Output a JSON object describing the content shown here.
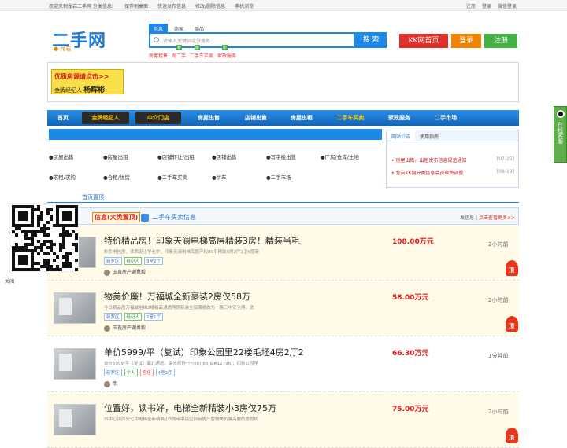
{
  "topbar": {
    "welcome": "欢迎来到龙岩二手网 分类信息!",
    "links": [
      "保存到桌面",
      "快速发布信息",
      "修改/删除信息",
      "手机浏览"
    ],
    "right": [
      "注册",
      "登录",
      "微信登录"
    ]
  },
  "header": {
    "logo": "二手网",
    "city": "龙岩",
    "search_tabs": [
      "信息",
      "商家",
      "商品"
    ],
    "search_placeholder": "请输入关键词或分类名",
    "search_button": "搜 索",
    "hot": [
      {
        "label": "房屋租售",
        "badge": ""
      },
      {
        "label": "淘二手",
        "badge": "新"
      },
      {
        "label": "二手车买卖",
        "badge": "新"
      },
      {
        "label": "家政服务",
        "badge": "新"
      }
    ],
    "buttons": {
      "home": "KK网首页",
      "login": "登录",
      "register": "注册"
    }
  },
  "banner": {
    "line1": "优质房源请点击>>",
    "line2_prefix": "金牌经纪人",
    "line2_name": "杨辉彬"
  },
  "nav": [
    "首页",
    "金牌经纪人",
    "中介门店",
    "房屋出售",
    "店铺出售",
    "房屋出租",
    "二手车买卖",
    "家政服务",
    "二手市场"
  ],
  "categories": [
    [
      "●房屋出售",
      "●房屋出租",
      "●店铺转让/出租",
      "●店铺出售",
      "●写字楼出售",
      "●厂房/仓库/土地"
    ],
    [
      "●求租/求购",
      "●合租/拼房",
      "●二手车买卖",
      "●拼车",
      "●二手市场"
    ]
  ],
  "notice": {
    "tabs": [
      "网站公告",
      "使用指南"
    ],
    "items": [
      {
        "text": "• 房屋出售、出租发布信息规范通知",
        "date": "[07-25]"
      },
      {
        "text": "• 龙岩KK网分类信息会员收费调整",
        "date": "[08-19]"
      }
    ]
  },
  "section_header": "首页置顶",
  "list": {
    "tab_a": "信息(大类置顶)",
    "tab_b": "二手车买卖信息",
    "right_prefix": "发信息",
    "right_link": "点击查看更多>>"
  },
  "items": [
    {
      "title": "特价精品房！印象天澜电梯高层精装3房！精装当毛",
      "desc": "秒杀书包房，读西安小学七中，印象天澜电梯高层产权89平精装3房2厅2卫9层新",
      "tags": [
        "新罗区",
        "经纪人",
        "3室2厅"
      ],
      "agent": "玉鑫房产谢勇毅",
      "price": "108.00万元",
      "time": "2小时前",
      "flame": "顶"
    },
    {
      "title": "物美价廉！万福城全新豪装2房仅58万",
      "desc": "今日精品房万福城电梯2楼精品通透两房新装全部满墙做为一路三中安全两，洗",
      "tags": [
        "新罗区",
        "经纪人",
        "2室1厅"
      ],
      "agent": "玉鑫房产谢勇毅",
      "price": "58.00万元",
      "time": "2小时前",
      "flame": "顶"
    },
    {
      "title": "单价5999/平（复试）印象公园里22楼毛坯4房2厅2",
      "desc": "单价5999/平（复试）面北通透。采光视野***(66)(66)&#12796;；印象公园里",
      "tags": [
        "新罗区",
        "个人",
        "毛坯",
        "4室2厅"
      ],
      "agent": "朋",
      "price": "66.30万元",
      "time": "1分钟前",
      "flame": ""
    },
    {
      "title": "位置好，读书好，电梯全新精装小3房仅75万",
      "desc": "市中心读西安七中电梯全新精装小3房带中央空调新房产型物美价廉高要的度假机",
      "tags": [],
      "agent": "",
      "price": "75.00万元",
      "time": "2小时前",
      "flame": "顶"
    }
  ],
  "qr_close": "关闭",
  "side_tab": "在线客服"
}
